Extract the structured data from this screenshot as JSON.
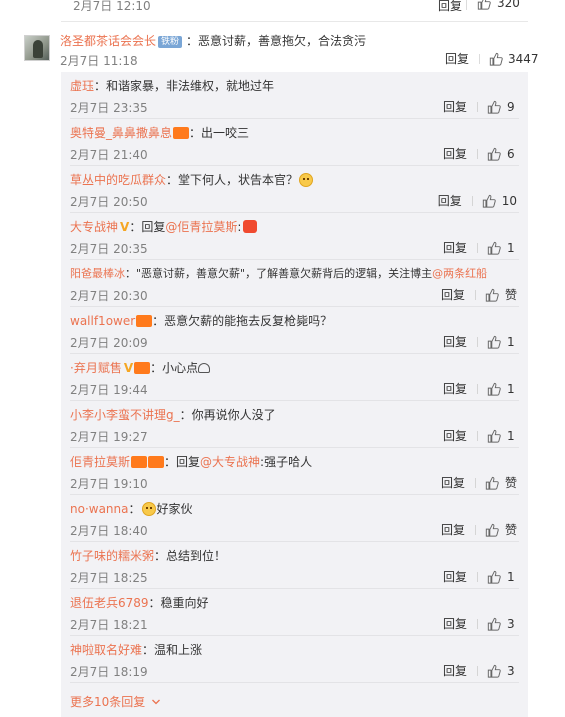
{
  "prev_comment": {
    "date": "2月7日 12:10",
    "reply_label": "回复",
    "likes": "320"
  },
  "main_comment": {
    "username": "洛圣都茶话会会长",
    "badge": "铁粉",
    "text": "：恶意讨薪，善意拖欠，合法贪污",
    "date": "2月7日 11:18",
    "reply_label": "回复",
    "likes": "3447"
  },
  "replies": [
    {
      "name": "虚珏",
      "text": "：和谐家暴，非法维权，就地过年",
      "date": "2月7日 23:35",
      "reply_label": "回复",
      "likes": "9"
    },
    {
      "name": "奥特曼_鼻鼻撒鼻息",
      "text": "：出一咬三",
      "date": "2月7日 21:40",
      "reply_label": "回复",
      "likes": "6"
    },
    {
      "name": "草丛中的吃瓜群众",
      "text": "：堂下何人，状告本官？",
      "date": "2月7日 20:50",
      "reply_label": "回复",
      "likes": "10"
    },
    {
      "name": "大专战神",
      "prefix": "：回复",
      "mention": "@佢青拉莫斯",
      "text": ":",
      "date": "2月7日 20:35",
      "reply_label": "回复",
      "likes": "1"
    },
    {
      "name": "阳爸最棒冰",
      "text": "：\"恶意讨薪，善意欠薪\"，了解善意欠薪背后的逻辑，关注博主",
      "mention": "@两条红船",
      "date": "2月7日 20:30",
      "reply_label": "回复",
      "likes": "赞"
    },
    {
      "name": "wallf1ower",
      "text": "：恶意欠薪的能拖去反复枪毙吗？",
      "date": "2月7日 20:09",
      "reply_label": "回复",
      "likes": "1"
    },
    {
      "name": "·弃月赋售",
      "text": "：小心点",
      "date": "2月7日 19:44",
      "reply_label": "回复",
      "likes": "1"
    },
    {
      "name": "小李小李蛮不讲理g_",
      "text": "：你再说你人没了",
      "date": "2月7日 19:27",
      "reply_label": "回复",
      "likes": "1"
    },
    {
      "name": "佢青拉莫斯",
      "prefix": "：回复",
      "mention": "@大专战神",
      "text": ":强子哈人",
      "date": "2月7日 19:10",
      "reply_label": "回复",
      "likes": "赞"
    },
    {
      "name": "no·wanna",
      "text": "好家伙",
      "date": "2月7日 18:40",
      "reply_label": "回复",
      "likes": "赞"
    },
    {
      "name": "竹子味的糯米粥",
      "text": "：总结到位！",
      "date": "2月7日 18:25",
      "reply_label": "回复",
      "likes": "1"
    },
    {
      "name": "退伍老兵6789",
      "text": "：稳重向好",
      "date": "2月7日 18:21",
      "reply_label": "回复",
      "likes": "3"
    },
    {
      "name": "神啦取名好难",
      "text": "：温和上涨",
      "date": "2月7日 18:19",
      "reply_label": "回复",
      "likes": "3"
    }
  ],
  "more_replies_label": "更多10条回复",
  "icons": {
    "like": "thumbs-up-icon",
    "more": "chevron-down-icon"
  },
  "colors": {
    "link": "#eb7350",
    "meta": "#808080",
    "reply_bg": "#f2f2f5"
  }
}
